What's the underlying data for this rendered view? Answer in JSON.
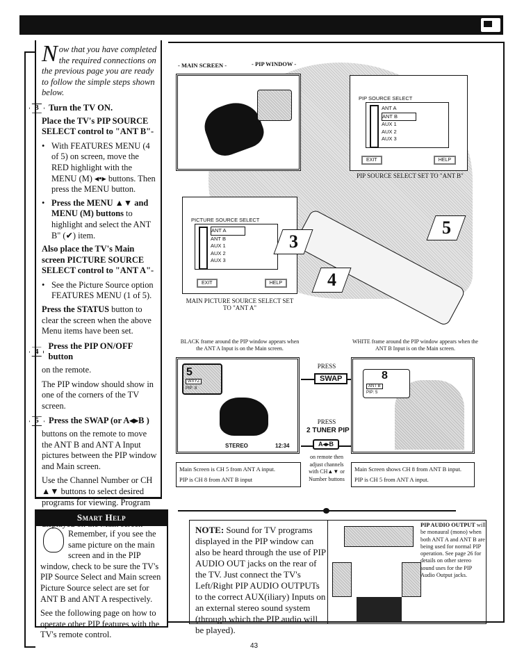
{
  "page_number": "43",
  "header": {
    "icon": "tv-screen-icon"
  },
  "left": {
    "intro_initial": "N",
    "intro": "ow that you have completed the required connections on the previous page you are ready to follow the simple steps shown below.",
    "step3": {
      "num": "3",
      "title": "Turn the TV ON.",
      "sub1": "Place the TV's PIP SOURCE SELECT control to \"ANT B\"-",
      "b1": "With FEATURES MENU (4 of 5) on screen, move the RED highlight with the MENU (M) ◂•▸ buttons. Then press the MENU button.",
      "b2_bold": "Press the MENU ▲▼ and MENU (M) buttons",
      "b2": " to highlight and select the ANT B\" (✔) item.",
      "sub2": "Also place the TV's Main screen PICTURE SOURCE SELECT control to \"ANT A\"-",
      "b3": "See the Picture Source option FEATURES MENU (1 of 5).",
      "status_bold": "Press the STATUS",
      "status": " button to clear the screen when the above Menu items have been set."
    },
    "step4": {
      "num": "4",
      "title": "Press the PIP ON/OFF button",
      "rest": "on the remote.",
      "p": "The PIP window should show in one of the corners of the TV screen."
    },
    "step5": {
      "num": "5",
      "title": "Press the SWAP (or A◂▸B )",
      "rest": "buttons on the remote to move the ANT B and ANT A Input pictures between the PIP window and Main screen.",
      "p": "Use the Channel Number or CH ▲▼ buttons to select desired programs for viewing. Program Sound occurs with the channels displayed on the Main screen"
    }
  },
  "smart_help": {
    "title": "Smart Help",
    "p1": "Remember, if you see the same picture on the main screen and in the PIP window, check to be sure the TV's PIP Source Select and Main screen Picture Source select are set for ANT B and ANT A respectively.",
    "p2": "See the following page on how to operate other PIP features with the TV's remote control."
  },
  "illustration": {
    "main_screen_label": "- MAIN SCREEN -",
    "pip_window_label": "- PIP WINDOW -",
    "pip_menu": {
      "title": "PIP SOURCE SELECT",
      "items": [
        "ANT A",
        "ANT B",
        "AUX 1",
        "AUX 2",
        "AUX 3"
      ],
      "selected": "ANT B",
      "exit": "EXIT",
      "help": "HELP",
      "caption": "PIP SOURCE SELECT SET TO \"ANT B\""
    },
    "pic_menu": {
      "title": "PICTURE SOURCE SELECT",
      "items": [
        "ANT A",
        "ANT B",
        "AUX 1",
        "AUX 2",
        "AUX 3"
      ],
      "selected": "ANT A",
      "exit": "EXIT",
      "help": "HELP",
      "caption": "MAIN PICTURE SOURCE SELECT SET TO \"ANT A\""
    },
    "callouts": [
      "3",
      "4",
      "5"
    ]
  },
  "swap_demo": {
    "left_caption": "BLACK frame around the PIP window appears when the ANT A Input is on the Main screen.",
    "right_caption": "WHITE frame around the PIP window appears when the ANT B Input is on the Main screen.",
    "left_pip": {
      "channel": "5",
      "station": "WXYZ",
      "pip": "PIP: 8"
    },
    "left_status": {
      "audio": "STEREO",
      "time": "12:34"
    },
    "right_pip": {
      "channel": "8",
      "station": "ANT B",
      "pip": "PIP: 5"
    },
    "press1": "PRESS",
    "swap": "SWAP",
    "press2": "PRESS",
    "tuner": "2 TUNER PIP",
    "tuner_btn": "A◂▸B",
    "remote_note": "on remote then adjust channels with CH▲▼ or Number buttons",
    "left_info": [
      "Main Screen is CH 5 from ANT A input.",
      "PIP is CH 8 from ANT B input"
    ],
    "right_info": [
      "Main Screen shows CH 8 from ANT B input.",
      "PIP is CH 5 from ANT A input."
    ]
  },
  "note": {
    "bold": "NOTE:",
    "text": " Sound for TV programs displayed in the PIP window can also be heard through the use of PIP AUDIO OUT jacks on the rear of the TV. Just connect the TV's Left/Right PIP AUDIO OUTPUTs to the correct AUX(iliary) Inputs on an external stereo sound system (through which the PIP audio will be played).",
    "side_bold": "PIP AUDIO OUTPUT",
    "side": " will be monaural (mono) when both ANT A and ANT B are being used for normal PIP operation. See page 26 for details on other stereo sound uses for the PIP Audio Output jacks."
  }
}
